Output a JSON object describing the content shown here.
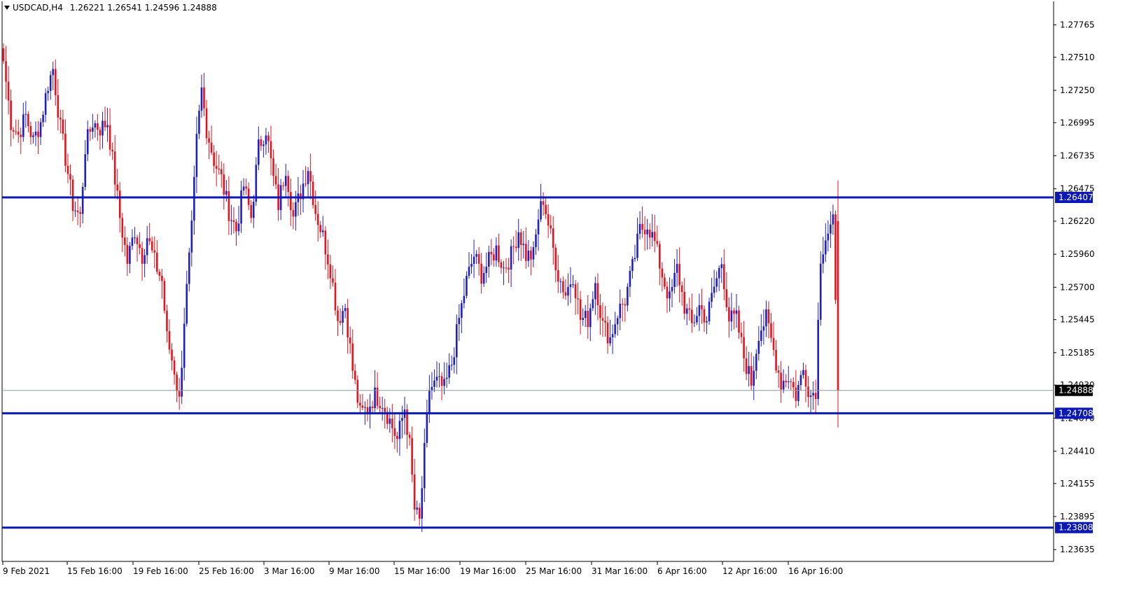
{
  "header": {
    "symbol": "USDCAD,H4",
    "open": "1.26221",
    "high": "1.26541",
    "low": "1.24596",
    "close": "1.24888"
  },
  "colors": {
    "bull": "#1f1fc8",
    "bear": "#e8121c",
    "level_line": "#0c18b4",
    "price_line": "#8c9a9a",
    "axis": "#000000"
  },
  "chart_data": {
    "type": "candlestick",
    "symbol": "USDCAD",
    "timeframe": "H4",
    "ylim": [
      1.2352,
      1.2795
    ],
    "y_ticks": [
      1.27765,
      1.2751,
      1.2725,
      1.26995,
      1.26735,
      1.26475,
      1.2622,
      1.2596,
      1.257,
      1.25445,
      1.25185,
      1.2493,
      1.2467,
      1.2441,
      1.24155,
      1.23895,
      1.23635
    ],
    "x_ticks": [
      "9 Feb 2021",
      "15 Feb 16:00",
      "19 Feb 16:00",
      "25 Feb 16:00",
      "3 Mar 16:00",
      "9 Mar 16:00",
      "15 Mar 16:00",
      "19 Mar 16:00",
      "25 Mar 16:00",
      "31 Mar 16:00",
      "6 Apr 16:00",
      "12 Apr 16:00",
      "16 Apr 16:00"
    ],
    "levels": [
      {
        "value": 1.26407,
        "label": "1.26407"
      },
      {
        "value": 1.24708,
        "label": "1.24708"
      },
      {
        "value": 1.23808,
        "label": "1.23808"
      }
    ],
    "current_price": {
      "value": 1.24888,
      "label": "1.24888"
    },
    "anchors": [
      [
        0,
        1.2748
      ],
      [
        3,
        1.27
      ],
      [
        6,
        1.269
      ],
      [
        9,
        1.2705
      ],
      [
        12,
        1.2685
      ],
      [
        15,
        1.27
      ],
      [
        18,
        1.273
      ],
      [
        20,
        1.2742
      ],
      [
        23,
        1.2695
      ],
      [
        26,
        1.266
      ],
      [
        28,
        1.2635
      ],
      [
        31,
        1.2625
      ],
      [
        33,
        1.268
      ],
      [
        36,
        1.27
      ],
      [
        39,
        1.2695
      ],
      [
        42,
        1.27
      ],
      [
        44,
        1.267
      ],
      [
        47,
        1.2625
      ],
      [
        50,
        1.259
      ],
      [
        53,
        1.2615
      ],
      [
        56,
        1.2595
      ],
      [
        58,
        1.261
      ],
      [
        61,
        1.259
      ],
      [
        64,
        1.2575
      ],
      [
        66,
        1.253
      ],
      [
        69,
        1.2505
      ],
      [
        71,
        1.248
      ],
      [
        73,
        1.2545
      ],
      [
        76,
        1.2615
      ],
      [
        78,
        1.2685
      ],
      [
        80,
        1.2725
      ],
      [
        82,
        1.2695
      ],
      [
        85,
        1.267
      ],
      [
        88,
        1.2655
      ],
      [
        91,
        1.263
      ],
      [
        94,
        1.2615
      ],
      [
        97,
        1.265
      ],
      [
        100,
        1.2625
      ],
      [
        103,
        1.268
      ],
      [
        106,
        1.2695
      ],
      [
        109,
        1.2655
      ],
      [
        111,
        1.2635
      ],
      [
        114,
        1.2665
      ],
      [
        117,
        1.2625
      ],
      [
        120,
        1.2645
      ],
      [
        123,
        1.2665
      ],
      [
        126,
        1.263
      ],
      [
        129,
        1.261
      ],
      [
        132,
        1.2585
      ],
      [
        135,
        1.2545
      ],
      [
        138,
        1.2555
      ],
      [
        141,
        1.2505
      ],
      [
        144,
        1.247
      ],
      [
        147,
        1.2475
      ],
      [
        150,
        1.2485
      ],
      [
        153,
        1.248
      ],
      [
        156,
        1.2465
      ],
      [
        159,
        1.245
      ],
      [
        162,
        1.2475
      ],
      [
        164,
        1.2445
      ],
      [
        166,
        1.2395
      ],
      [
        168,
        1.2385
      ],
      [
        170,
        1.244
      ],
      [
        172,
        1.249
      ],
      [
        175,
        1.2495
      ],
      [
        178,
        1.249
      ],
      [
        181,
        1.251
      ],
      [
        184,
        1.2545
      ],
      [
        187,
        1.2575
      ],
      [
        190,
        1.2595
      ],
      [
        193,
        1.258
      ],
      [
        196,
        1.259
      ],
      [
        199,
        1.26
      ],
      [
        202,
        1.2585
      ],
      [
        205,
        1.2595
      ],
      [
        208,
        1.2615
      ],
      [
        211,
        1.2595
      ],
      [
        214,
        1.2595
      ],
      [
        216,
        1.2625
      ],
      [
        218,
        1.264
      ],
      [
        221,
        1.261
      ],
      [
        224,
        1.258
      ],
      [
        227,
        1.2565
      ],
      [
        230,
        1.258
      ],
      [
        233,
        1.2545
      ],
      [
        236,
        1.2545
      ],
      [
        239,
        1.2575
      ],
      [
        242,
        1.254
      ],
      [
        245,
        1.253
      ],
      [
        248,
        1.255
      ],
      [
        251,
        1.256
      ],
      [
        254,
        1.2585
      ],
      [
        257,
        1.2615
      ],
      [
        260,
        1.262
      ],
      [
        263,
        1.2605
      ],
      [
        266,
        1.258
      ],
      [
        269,
        1.256
      ],
      [
        272,
        1.2585
      ],
      [
        275,
        1.2555
      ],
      [
        278,
        1.254
      ],
      [
        281,
        1.2555
      ],
      [
        284,
        1.2545
      ],
      [
        287,
        1.257
      ],
      [
        290,
        1.259
      ],
      [
        293,
        1.2545
      ],
      [
        296,
        1.2545
      ],
      [
        299,
        1.2515
      ],
      [
        302,
        1.2495
      ],
      [
        305,
        1.2535
      ],
      [
        308,
        1.2545
      ],
      [
        311,
        1.252
      ],
      [
        314,
        1.2495
      ],
      [
        317,
        1.25
      ],
      [
        320,
        1.2485
      ],
      [
        323,
        1.2505
      ],
      [
        326,
        1.2485
      ],
      [
        328,
        1.249
      ],
      [
        330,
        1.2595
      ],
      [
        332,
        1.261
      ],
      [
        335,
        1.262
      ],
      [
        337,
        1.2488
      ]
    ],
    "last_candle": {
      "open": 1.26221,
      "high": 1.26541,
      "low": 1.24596,
      "close": 1.24888
    },
    "title": "",
    "xlabel": "",
    "ylabel": "",
    "grid": false,
    "legend": "none"
  }
}
